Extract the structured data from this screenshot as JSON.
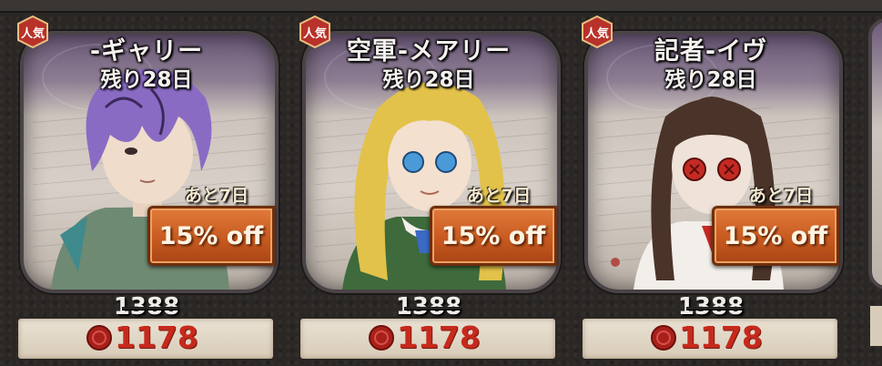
{
  "cards": [
    {
      "name": "-ギャリー",
      "remaining": "残り28日",
      "countdown": "あと7日",
      "discount": "15% off",
      "original_price": "1388",
      "sale_price": "1178",
      "hair_color": "#8a6bc4",
      "outfit_color": "#6f8a72"
    },
    {
      "name": "空軍-メアリー",
      "remaining": "残り28日",
      "countdown": "あと7日",
      "discount": "15% off",
      "original_price": "1388",
      "sale_price": "1178",
      "hair_color": "#e2c24a",
      "outfit_color": "#3e6a3c"
    },
    {
      "name": "記者-イヴ",
      "remaining": "残り28日",
      "countdown": "あと7日",
      "discount": "15% off",
      "original_price": "1388",
      "sale_price": "1178",
      "hair_color": "#4a3328",
      "outfit_color": "#f2eeea"
    }
  ],
  "badge": {
    "label": "人気",
    "color": "#b8322a"
  },
  "currency_icon": "red-seal-icon",
  "colors": {
    "discount_banner": "#d0652a",
    "sale_price": "#c62a1c"
  }
}
